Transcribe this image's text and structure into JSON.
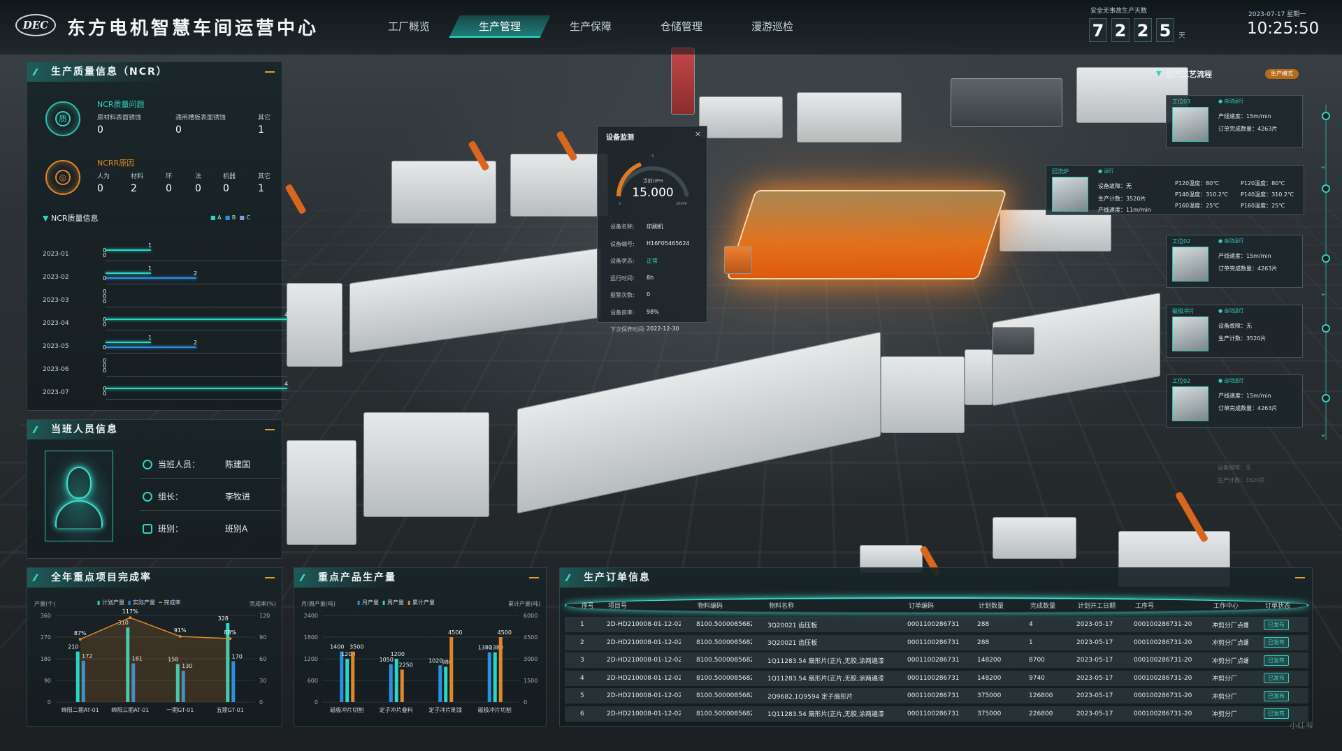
{
  "header": {
    "logo": "DEC",
    "title": "东方电机智慧车间运营中心",
    "nav": [
      "工厂概览",
      "生产管理",
      "生产保障",
      "仓储管理",
      "漫游巡检"
    ],
    "active_nav": 1,
    "safe_label": "安全无事故生产天数",
    "safe_digits": [
      "7",
      "2",
      "2",
      "5"
    ],
    "safe_unit": "天",
    "date": "2023-07-17  星期一",
    "time": "10:25:50"
  },
  "ncr": {
    "title": "生产质量信息（NCR）",
    "q_title": "NCR质量问题",
    "q_icon": "质",
    "q_items": [
      {
        "k": "原材料表面锈蚀",
        "v": "0"
      },
      {
        "k": "通用槽板表面锈蚀",
        "v": "0"
      },
      {
        "k": "其它",
        "v": "1"
      }
    ],
    "r_title": "NCRR原因",
    "r_items": [
      {
        "k": "人为",
        "v": "0"
      },
      {
        "k": "材料",
        "v": "2"
      },
      {
        "k": "环",
        "v": "0"
      },
      {
        "k": "法",
        "v": "0"
      },
      {
        "k": "机器",
        "v": "0"
      },
      {
        "k": "其它",
        "v": "1"
      }
    ],
    "chart_title": "NCR质量信息",
    "legend": [
      "A",
      "B",
      "C"
    ],
    "months": [
      "2023-01",
      "2023-02",
      "2023-03",
      "2023-04",
      "2023-05",
      "2023-06",
      "2023-07"
    ]
  },
  "chart_data": [
    {
      "type": "bar",
      "title": "NCR质量信息",
      "orientation": "horizontal",
      "legend": [
        "A",
        "B",
        "C"
      ],
      "categories": [
        "2023-01",
        "2023-02",
        "2023-03",
        "2023-04",
        "2023-05",
        "2023-06",
        "2023-07"
      ],
      "series": [
        {
          "name": "A",
          "values": [
            1,
            1,
            0,
            4,
            1,
            0,
            4
          ]
        },
        {
          "name": "B",
          "values": [
            0,
            2,
            0,
            0,
            2,
            0,
            0
          ]
        },
        {
          "name": "C",
          "values": [
            0,
            0,
            0,
            0,
            0,
            0,
            0
          ]
        }
      ]
    },
    {
      "type": "bar",
      "title": "全年重点项目完成率",
      "categories": [
        "绵阳二期AT-01",
        "绵阳三期AT-01",
        "一期GT-01",
        "五期GT-01"
      ],
      "yleft_label": "产量(个)",
      "yleft_ticks": [
        0,
        90,
        180,
        270,
        360
      ],
      "yright_label": "完成率(%)",
      "yright_ticks": [
        0,
        30,
        60,
        90,
        120
      ],
      "series": [
        {
          "name": "计划产量",
          "values": [
            210,
            310,
            158,
            328
          ]
        },
        {
          "name": "实际产量",
          "values": [
            172,
            161,
            130,
            170
          ]
        },
        {
          "name": "完成率",
          "type": "line",
          "labels": [
            {
              "x": 0,
              "v": "87%"
            },
            {
              "x": 1,
              "v": "117%"
            },
            {
              "x": 2,
              "v": "91%"
            },
            {
              "x": 3,
              "v": "88%"
            }
          ]
        }
      ]
    },
    {
      "type": "bar",
      "title": "重点产品生产量",
      "categories": [
        "磁极冲片切割",
        "定子冲片叠料",
        "定子冲片刷漆",
        "磁极冲片切割"
      ],
      "yleft_label": "月/周产量(吨)",
      "yleft_ticks": [
        0,
        600,
        1200,
        1800,
        2400
      ],
      "yright_label": "累计产量(吨)",
      "yright_ticks": [
        0,
        1500,
        3000,
        4500,
        6000
      ],
      "series": [
        {
          "name": "月产量",
          "values": [
            1400,
            1050,
            1020,
            1380
          ]
        },
        {
          "name": "周产量",
          "values": [
            1200,
            1200,
            980,
            1380
          ]
        },
        {
          "name": "累计产量",
          "values": [
            3500,
            2250,
            4500,
            4500
          ]
        }
      ]
    }
  ],
  "person": {
    "title": "当班人员信息",
    "rows": [
      {
        "label": "当班人员：",
        "value": "陈建国"
      },
      {
        "label": "组长：",
        "value": "李牧进"
      },
      {
        "label": "班别：",
        "value": "班别A"
      }
    ]
  },
  "projects": {
    "title": "全年重点项目完成率",
    "legend": [
      "计划产量",
      "实际产量",
      "完成率"
    ],
    "ylabel": "产量(个)",
    "ylabel2": "完成率(%)"
  },
  "products": {
    "title": "重点产品生产量",
    "legend": [
      "月产量",
      "周产量",
      "累计产量"
    ],
    "ylabel": "月/周产量(吨)",
    "ylabel2": "累计产量(吨)"
  },
  "device": {
    "title": "设备监测",
    "close": "×",
    "gauge_label": "当前UPH",
    "gauge_value": "15.000",
    "gauge_min": "0",
    "gauge_max": "20000",
    "rows": [
      {
        "k": "设备名称:",
        "v": "印刷机"
      },
      {
        "k": "设备编号:",
        "v": "H16F05465624"
      },
      {
        "k": "设备状态:",
        "v": "正常"
      },
      {
        "k": "运行时间:",
        "v": "8h"
      },
      {
        "k": "报警次数:",
        "v": "0"
      },
      {
        "k": "设备良率:",
        "v": "98%"
      },
      {
        "k": "下次保养时间:",
        "v": "2022-12-30"
      }
    ]
  },
  "flow": {
    "title": "生产工艺流程",
    "mode": "生产模式",
    "cards": [
      {
        "tag": "工位03",
        "status": "● 自动运行",
        "l1": "产线速度：15m/min",
        "l2": "订单完成数量：4263片"
      },
      {
        "tag": "回流炉",
        "status": "● 运行",
        "l1": "设备故障：无",
        "l2": "生产计数：3520片",
        "l3": "产线速度：11m/min",
        "c2": [
          "P120温度：80℃",
          "P140温度：310.2℃",
          "P160温度：25℃"
        ],
        "c3": [
          "P120温度：80℃",
          "P140温度：310.2℃",
          "P160温度：25℃"
        ]
      },
      {
        "tag": "工位02",
        "status": "● 自动运行",
        "l1": "产线速度：15m/min",
        "l2": "订单完成数量：4263片"
      },
      {
        "tag": "磁极冲片",
        "status": "● 自动运行",
        "l1": "设备故障：无",
        "l2": "生产计数：3520片"
      },
      {
        "tag": "工位02",
        "status": "● 自动运行",
        "l1": "产线速度：15m/min",
        "l2": "订单完成数量：4263片"
      }
    ],
    "ghost": [
      "设备故障：无",
      "生产计数：3520片"
    ]
  },
  "orders": {
    "title": "生产订单信息",
    "columns": [
      "序号",
      "项目号",
      "物料编码",
      "物料名称",
      "订单编码",
      "计划数量",
      "完成数量",
      "计划开工日期",
      "工序号",
      "工作中心",
      "订单状态"
    ],
    "rows": [
      [
        "1",
        "2D-HD210008-01-12-02",
        "8100.5000085682",
        "3Q20021 齿压板",
        "0001100286731",
        "288",
        "4",
        "2023-05-17",
        "000100286731-20",
        "冲剪分厂点螺机",
        "已发布"
      ],
      [
        "2",
        "2D-HD210008-01-12-02",
        "8100.5000085682",
        "3Q20021 齿压板",
        "0001100286731",
        "288",
        "1",
        "2023-05-17",
        "000100286731-20",
        "冲剪分厂点螺机",
        "已发布"
      ],
      [
        "3",
        "2D-HD210008-01-12-02",
        "8100.5000085682",
        "1Q11283.54 扇形片(正片,无胶,涂两遍漆",
        "0001100286731",
        "148200",
        "8700",
        "2023-05-17",
        "000100286731-20",
        "冲剪分厂点螺机",
        "已发布"
      ],
      [
        "4",
        "2D-HD210008-01-12-02",
        "8100.5000085682",
        "1Q11283.54 扇形片(正片,无胶,涂两遍漆",
        "0001100286731",
        "148200",
        "9740",
        "2023-05-17",
        "000100286731-20",
        "冲剪分厂",
        "已发布"
      ],
      [
        "5",
        "2D-HD210008-01-12-02",
        "8100.5000085682",
        "2Q9682,1Q9594 定子扇形片",
        "0001100286731",
        "375000",
        "126800",
        "2023-05-17",
        "000100286731-20",
        "冲剪分厂",
        "已发布"
      ],
      [
        "6",
        "2D-HD210008-01-12-02",
        "8100.5000085682",
        "1Q11283.54 扇形片(正片,无胶,涂两遍漆",
        "0001100286731",
        "375000",
        "226800",
        "2023-05-17",
        "000100286731-20",
        "冲剪分厂",
        "已发布"
      ]
    ]
  },
  "watermark": "小红书"
}
